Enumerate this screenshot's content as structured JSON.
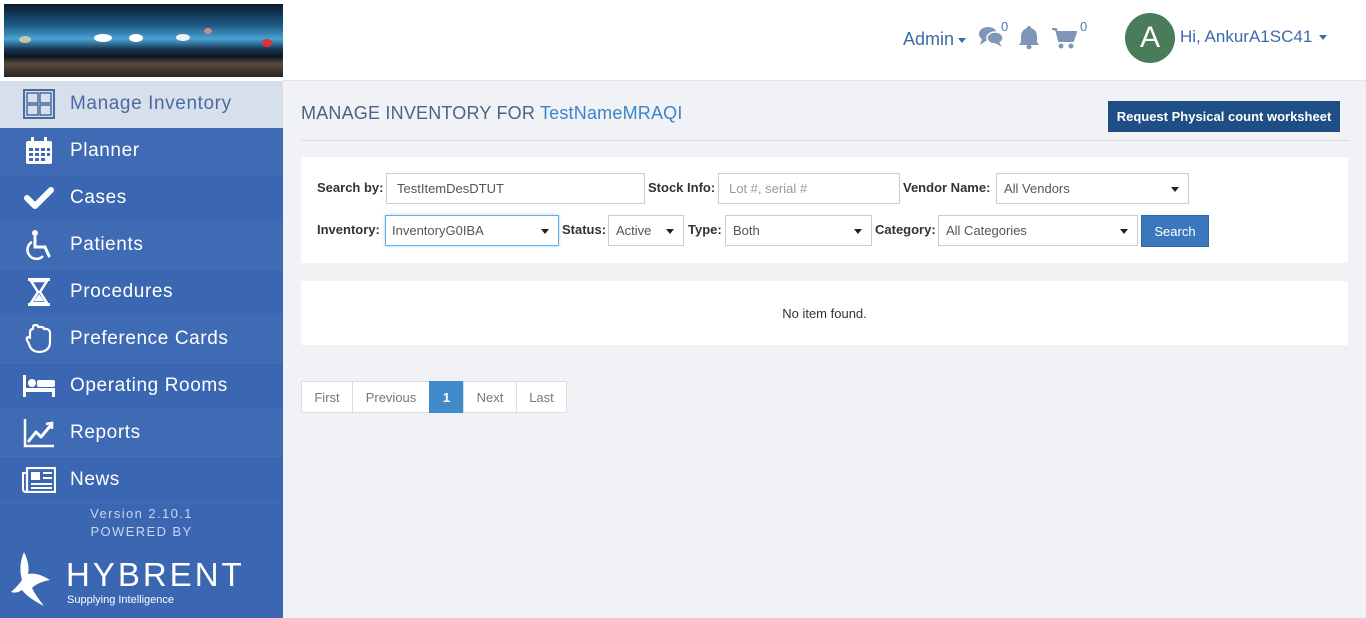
{
  "header": {
    "admin_label": "Admin",
    "messages_count": "0",
    "cart_count": "0",
    "avatar_initial": "A",
    "greeting": "Hi, AnkurA1SC41"
  },
  "sidebar": {
    "items": [
      {
        "label": "Manage Inventory",
        "icon": "inventory-grid-icon"
      },
      {
        "label": "Planner",
        "icon": "calendar-icon"
      },
      {
        "label": "Cases",
        "icon": "checkmark-icon"
      },
      {
        "label": "Patients",
        "icon": "wheelchair-icon"
      },
      {
        "label": "Procedures",
        "icon": "hourglass-icon"
      },
      {
        "label": "Preference Cards",
        "icon": "hand-icon"
      },
      {
        "label": "Operating Rooms",
        "icon": "bed-icon"
      },
      {
        "label": "Reports",
        "icon": "chart-line-icon"
      },
      {
        "label": "News",
        "icon": "newspaper-icon"
      }
    ],
    "version": "Version 2.10.1",
    "powered_by": "POWERED BY",
    "brand_name": "HYBRENT",
    "brand_tagline": "Supplying Intelligence"
  },
  "main": {
    "title_prefix": "MANAGE INVENTORY FOR",
    "title_name": "TestNameMRAQI",
    "request_button": "Request Physical count worksheet",
    "filters": {
      "search_by_label": "Search by:",
      "search_by_value": "TestItemDesDTUT",
      "stock_info_label": "Stock Info:",
      "stock_info_placeholder": "Lot #, serial #",
      "vendor_label": "Vendor Name:",
      "vendor_value": "All Vendors",
      "inventory_label": "Inventory:",
      "inventory_value": "InventoryG0IBA",
      "status_label": "Status:",
      "status_value": "Active",
      "type_label": "Type:",
      "type_value": "Both",
      "category_label": "Category:",
      "category_value": "All Categories",
      "search_button": "Search"
    },
    "empty_message": "No item found.",
    "pagination": {
      "first": "First",
      "previous": "Previous",
      "current": "1",
      "next": "Next",
      "last": "Last"
    }
  },
  "colors": {
    "sidebar": "#3b67b2",
    "active_item_bg": "#d7e0ea",
    "primary_button": "#1f4e85",
    "accent": "#3a86c8"
  }
}
